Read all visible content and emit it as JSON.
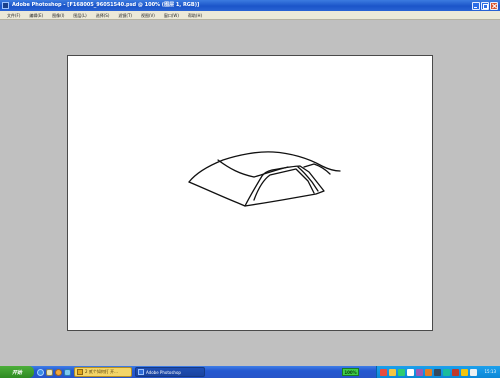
{
  "window": {
    "title": "Adobe Photoshop - [F168005_96051540.psd @ 100% (图层 1, RGB)]"
  },
  "menu": {
    "items": [
      "文件(F)",
      "编辑(E)",
      "图像(I)",
      "图层(L)",
      "选择(S)",
      "滤镜(T)",
      "视图(V)",
      "窗口(W)",
      "帮助(H)"
    ]
  },
  "taskbar": {
    "start_label": "开始",
    "tasks": [
      {
        "label": "2 贰个如何打 开...",
        "icon": "folder-icon"
      },
      {
        "label": "Adobe Photoshop",
        "icon": "photoshop-icon"
      }
    ],
    "tray_badge": "100%",
    "clock": "15:13"
  },
  "colors": {
    "workspace": "#c0c0c0",
    "titlebar": "#1b55c9",
    "taskbar": "#2458d0",
    "start": "#3a9b2e"
  },
  "icons": {
    "quick_launch": [
      "internet-explorer-icon",
      "show-desktop-icon",
      "media-player-icon",
      "app-icon"
    ],
    "tray": [
      "tray-icon-1",
      "tray-icon-2",
      "tray-icon-3",
      "tray-icon-4",
      "tray-icon-5",
      "tray-icon-6",
      "tray-icon-7",
      "tray-icon-8",
      "tray-icon-9",
      "tray-icon-10",
      "tray-icon-11"
    ]
  }
}
